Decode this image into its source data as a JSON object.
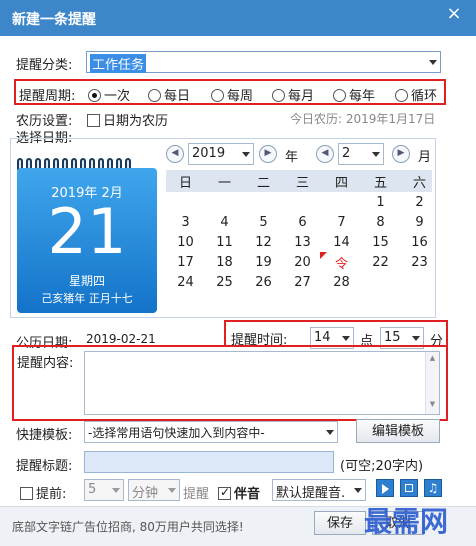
{
  "window": {
    "title": "新建一条提醒",
    "close": "×"
  },
  "category": {
    "label": "提醒分类:",
    "value": "工作任务"
  },
  "period": {
    "label": "提醒周期:",
    "options": [
      "一次",
      "每日",
      "每周",
      "每月",
      "每年",
      "循环"
    ],
    "selected": "一次"
  },
  "lunar": {
    "label": "农历设置:",
    "checkbox_label": "日期为农历",
    "today_lunar": "今日农历: 2019年1月17日"
  },
  "select_date_label": "选择日期:",
  "calendar_nav": {
    "year": "2019",
    "year_unit": "年",
    "month": "2",
    "month_unit": "月"
  },
  "weekdays": [
    "日",
    "一",
    "二",
    "三",
    "四",
    "五",
    "六"
  ],
  "calendar_rows": [
    [
      "",
      "",
      "",
      "",
      "",
      "1",
      "2"
    ],
    [
      "3",
      "4",
      "5",
      "6",
      "7",
      "8",
      "9"
    ],
    [
      "10",
      "11",
      "12",
      "13",
      "14",
      "15",
      "16"
    ],
    [
      "17",
      "18",
      "19",
      "20",
      "令",
      "22",
      "23"
    ],
    [
      "24",
      "25",
      "26",
      "27",
      "28",
      "",
      ""
    ]
  ],
  "big_calendar": {
    "year_month": "2019年  2月",
    "day": "21",
    "weekday": "星期四",
    "lunar": "己亥猪年  正月十七"
  },
  "gregorian": {
    "label": "公历日期:",
    "value": "2019-02-21"
  },
  "time": {
    "label": "提醒时间:",
    "hour": "14",
    "hour_unit": "点",
    "minute": "15",
    "minute_unit": "分"
  },
  "content": {
    "label": "提醒内容:"
  },
  "template": {
    "label": "快捷模板:",
    "value": "-选择常用语句快速加入到内容中-",
    "edit_button": "编辑模板"
  },
  "reminder_title": {
    "label": "提醒标题:",
    "hint": "(可空;20字内)"
  },
  "advance": {
    "label": "提前:",
    "amount": "5",
    "unit": "分钟",
    "suffix": "提醒",
    "sound_label": "伴音",
    "sound_value": "默认提醒音."
  },
  "footer": {
    "ad": "底部文字链广告位招商, 80万用户共同选择!",
    "save": "保存",
    "cancel": "取消"
  },
  "watermark": "最需网",
  "colors": {
    "titlebar": "#3c86c9",
    "highlight": "#e02020",
    "selection": "#3a8ee6"
  }
}
